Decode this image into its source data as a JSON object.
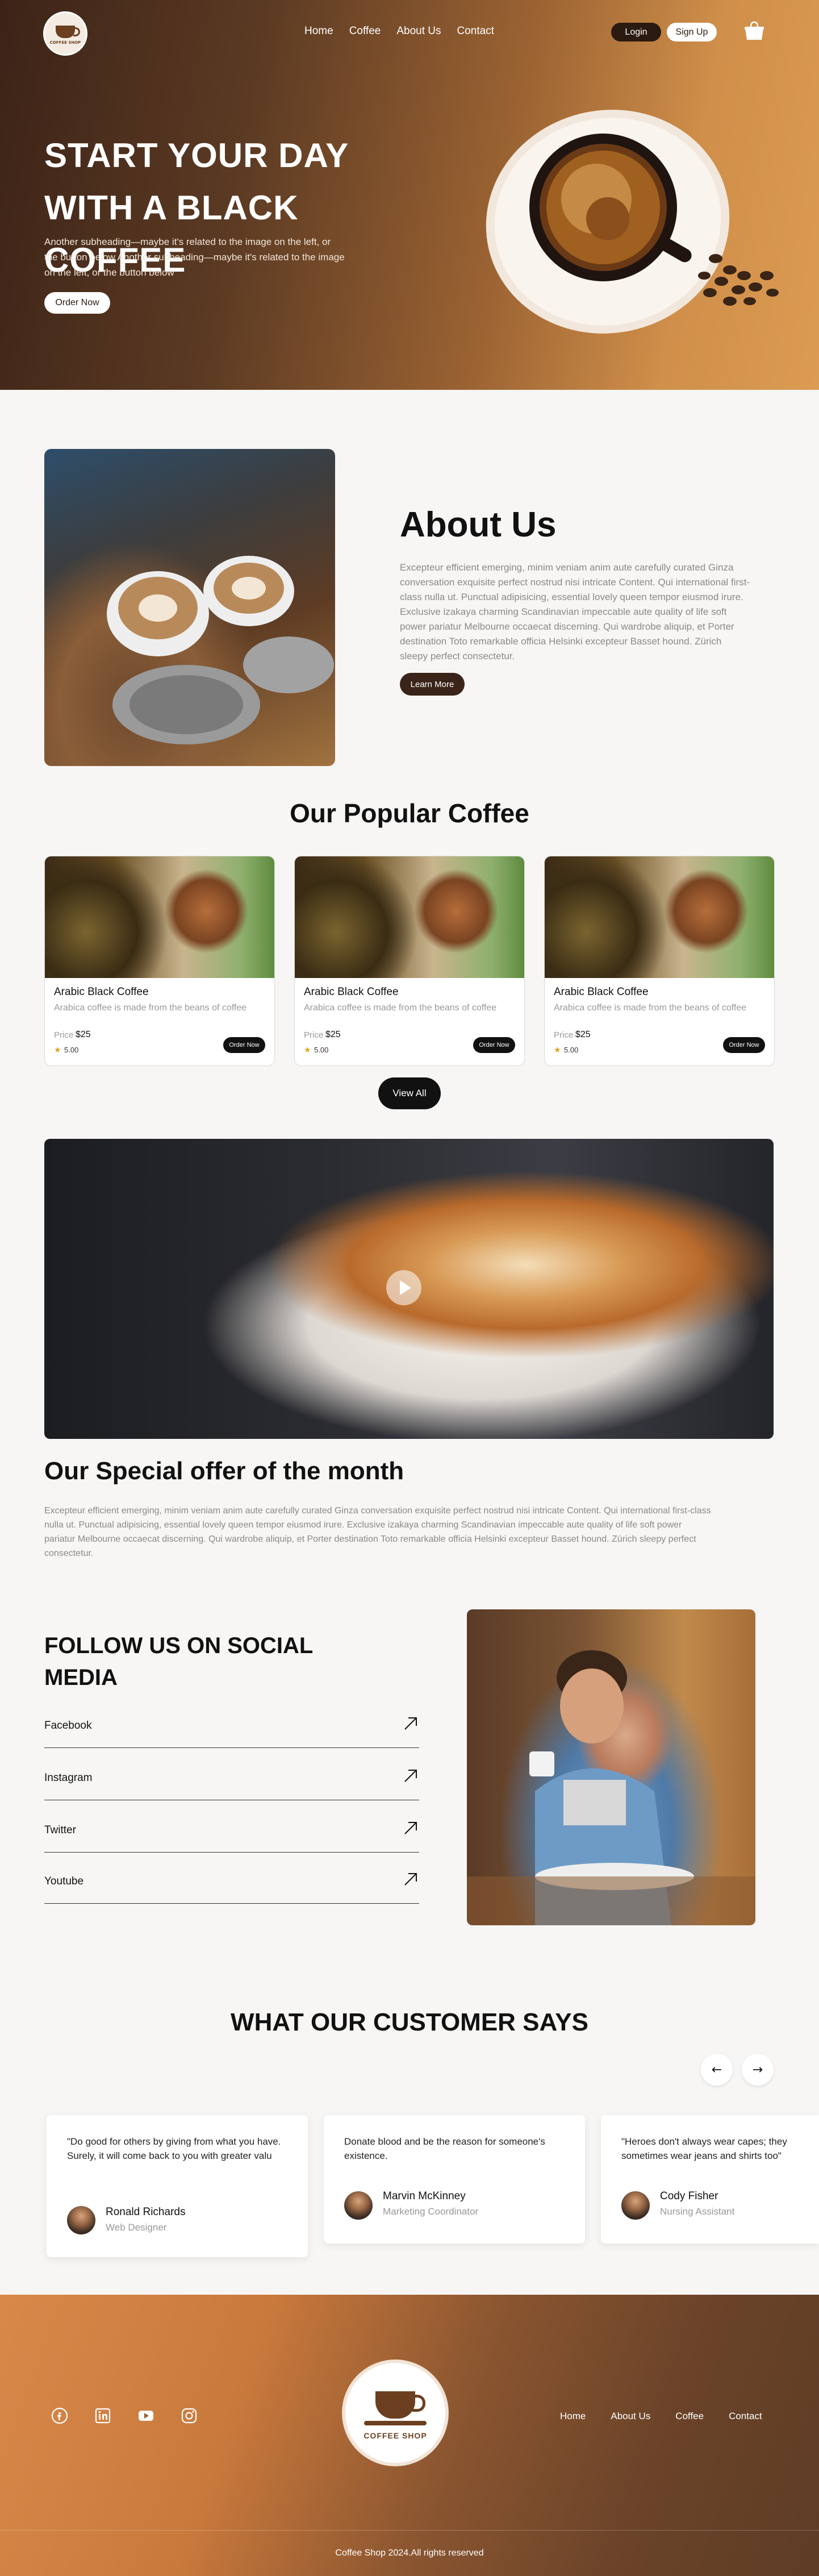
{
  "brand": {
    "logo_text": "COFFEE SHOP"
  },
  "nav": {
    "items": [
      "Home",
      "Coffee",
      "About Us",
      "Contact"
    ],
    "login": "Login",
    "signup": "Sign Up"
  },
  "hero": {
    "title": "START YOUR DAY WITH A BLACK COFFEE",
    "subtitle": "Another subheading—maybe it's related to the image on the left, or the button below Another subheading—maybe it's related to the image on the left, or the button below",
    "cta": "Order Now"
  },
  "about": {
    "title": "About Us",
    "text": "Excepteur efficient emerging, minim veniam anim aute carefully curated Ginza conversation exquisite perfect nostrud nisi intricate Content. Qui international first-class nulla ut. Punctual adipisicing, essential lovely queen tempor eiusmod irure. Exclusive izakaya charming Scandinavian impeccable aute quality of life soft power pariatur Melbourne occaecat discerning. Qui wardrobe aliquip, et Porter destination Toto remarkable officia Helsinki excepteur Basset hound. Zürich sleepy perfect consectetur.",
    "cta": "Learn More"
  },
  "popular": {
    "title": "Our Popular Coffee",
    "cards": [
      {
        "name": "Arabic Black Coffee",
        "desc": "Arabica coffee is made from the beans of coffee",
        "price_label": "Price",
        "price": "$25",
        "rating": "5.00",
        "cta": "Order Now"
      },
      {
        "name": "Arabic Black Coffee",
        "desc": "Arabica coffee is made from the beans of coffee",
        "price_label": "Price",
        "price": "$25",
        "rating": "5.00",
        "cta": "Order Now"
      },
      {
        "name": "Arabic Black Coffee",
        "desc": "Arabica coffee is made from the beans of coffee",
        "price_label": "Price",
        "price": "$25",
        "rating": "5.00",
        "cta": "Order Now"
      }
    ],
    "view_all": "View All"
  },
  "offer": {
    "title": "Our Special offer of the month",
    "text": "Excepteur efficient emerging, minim veniam anim aute carefully curated Ginza conversation exquisite perfect nostrud nisi intricate Content. Qui international first-class nulla ut. Punctual adipisicing, essential lovely queen tempor eiusmod irure. Exclusive izakaya charming Scandinavian impeccable aute quality of life soft power pariatur Melbourne occaecat discerning. Qui wardrobe aliquip, et Porter destination Toto remarkable officia Helsinki excepteur Basset hound. Zürich sleepy perfect consectetur."
  },
  "social": {
    "title": "FOLLOW US ON SOCIAL MEDIA",
    "links": [
      "Facebook",
      "Instagram",
      "Twitter",
      "Youtube"
    ]
  },
  "testimonials": {
    "title": "WHAT OUR CUSTOMER SAYS",
    "items": [
      {
        "quote": "\"Do good for others by giving from what you have. Surely, it will come back to you with greater valu",
        "name": "Ronald Richards",
        "role": "Web Designer"
      },
      {
        "quote": "Donate blood and be the reason for someone's existence.",
        "name": "Marvin McKinney",
        "role": "Marketing Coordinator"
      },
      {
        "quote": "\"Heroes don't always wear capes; they sometimes wear jeans and shirts too\"",
        "name": "Cody Fisher",
        "role": "Nursing Assistant"
      }
    ]
  },
  "footer": {
    "logo_text": "COFFEE SHOP",
    "nav": [
      "Home",
      "About Us",
      "Coffee",
      "Contact"
    ],
    "copyright": "Coffee Shop 2024.All rights reserved"
  }
}
